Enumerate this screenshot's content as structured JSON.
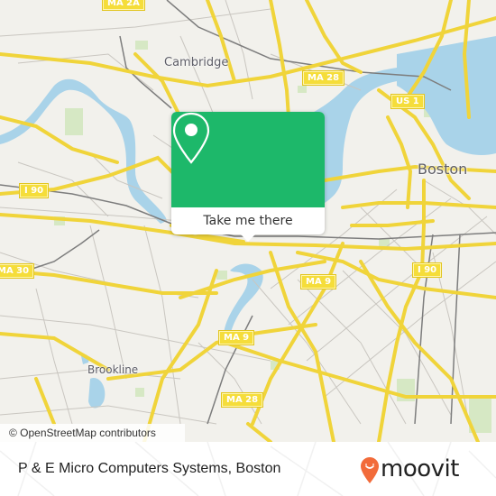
{
  "map": {
    "places": [
      {
        "id": "cambridge",
        "label": "Cambridge"
      },
      {
        "id": "boston",
        "label": "Boston"
      },
      {
        "id": "brookline",
        "label": "Brookline"
      }
    ],
    "road_shields": [
      {
        "id": "ma2a",
        "label": "MA 2A"
      },
      {
        "id": "ma28-north",
        "label": "MA 28"
      },
      {
        "id": "us1",
        "label": "US 1"
      },
      {
        "id": "i90-west",
        "label": "I 90"
      },
      {
        "id": "ma30",
        "label": "MA 30"
      },
      {
        "id": "ma9-east",
        "label": "MA 9"
      },
      {
        "id": "i90-east",
        "label": "I 90"
      },
      {
        "id": "ma9-south",
        "label": "MA 9"
      },
      {
        "id": "ma28-south",
        "label": "MA 28"
      }
    ],
    "attribution": "© OpenStreetMap contributors",
    "colors": {
      "land": "#f2f1ec",
      "water": "#a9d3e9",
      "park": "#d6e8c4",
      "major_road": "#f7df5e",
      "minor_road": "#c9c6c0",
      "rail": "#7d7d7d"
    }
  },
  "popup": {
    "icon": "location-pin-icon",
    "button_label": "Take me there",
    "accent": "#1db86a"
  },
  "footer": {
    "title": "P & E Micro Computers Systems, Boston",
    "brand": "moovit",
    "brand_color": "#f26b3a"
  }
}
